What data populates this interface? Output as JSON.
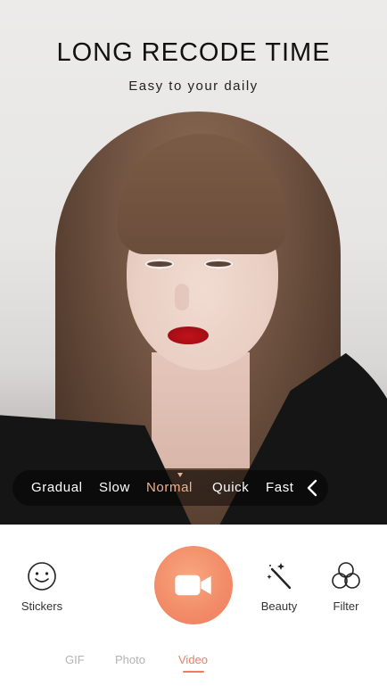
{
  "banner": {
    "title": "LONG RECODE TIME",
    "subtitle": "Easy to your daily"
  },
  "speed": {
    "options": [
      "Gradual",
      "Slow",
      "Normal",
      "Quick",
      "Fast"
    ],
    "selected": "Normal"
  },
  "toolbar": {
    "stickers_label": "Stickers",
    "beauty_label": "Beauty",
    "filter_label": "Filter"
  },
  "modes": {
    "items": [
      "GIF",
      "Photo",
      "Video"
    ],
    "selected": "Video"
  },
  "colors": {
    "accent": "#ef7d63",
    "speed_active": "#f0b08f",
    "record_button": "#f28b67"
  }
}
